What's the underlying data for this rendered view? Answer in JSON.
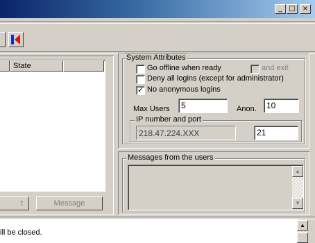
{
  "window": {
    "minimize_glyph": "_",
    "maximize_glyph": "□",
    "close_glyph": "×"
  },
  "users_table": {
    "columns": [
      "",
      "State",
      ""
    ]
  },
  "buttons": {
    "partial_left_label": "t",
    "message_label": "Message"
  },
  "system_attributes": {
    "title": "System Attributes",
    "go_offline": {
      "label": "Go offline when ready",
      "checked": false
    },
    "and_exit": {
      "label": "and exit",
      "checked": false,
      "enabled": false
    },
    "deny_logins": {
      "label": "Deny all logins (except for administrator)",
      "checked": false
    },
    "no_anonymous": {
      "label": "No anonymous logins",
      "checked": true
    },
    "max_users_label": "Max Users",
    "max_users_value": "5",
    "anon_label": "Anon.",
    "anon_value": "10",
    "ip_group_title": "IP number and port",
    "ip_value": "218.47.224.XXX",
    "port_value": "21"
  },
  "messages": {
    "title": "Messages from the users"
  },
  "status": {
    "text": "ill be closed."
  },
  "colors": {
    "titlebar_start": "#0a246a",
    "titlebar_end": "#a6caf0",
    "face": "#d4d0c8",
    "toolbar_icon_blue": "#1030c0",
    "toolbar_icon_red": "#e01010"
  }
}
